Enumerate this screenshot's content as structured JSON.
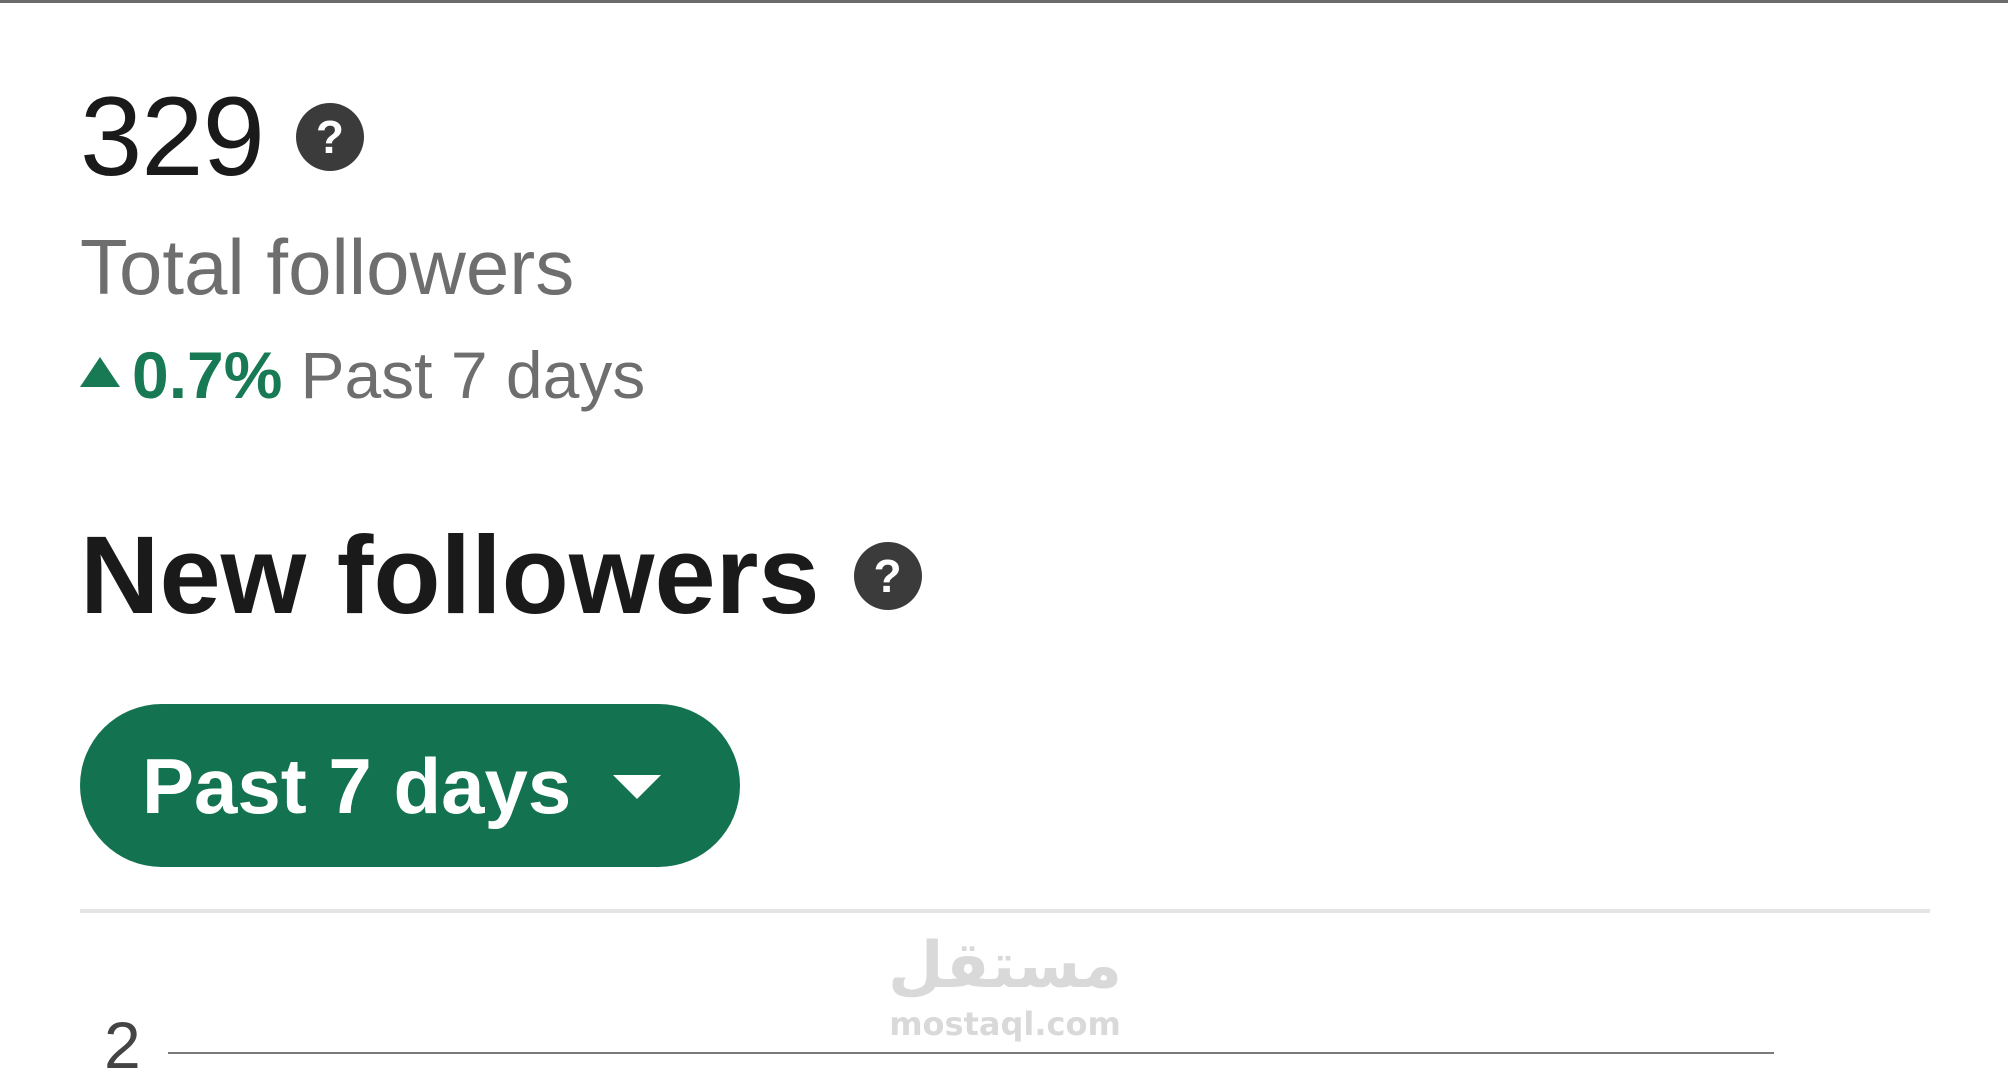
{
  "total": {
    "count": "329",
    "help_icon": "question-circle-icon",
    "label": "Total followers",
    "change": {
      "direction_icon": "triangle-up-icon",
      "percent": "0.7%",
      "period": "Past 7 days"
    }
  },
  "new_followers": {
    "title": "New followers",
    "help_icon": "question-circle-icon",
    "range_select": {
      "value": "Past 7 days",
      "caret_icon": "caret-down-icon"
    },
    "chart_partial": {
      "visible_tick": "2"
    }
  },
  "watermark": {
    "brand": "مستقل",
    "url": "mostaql.com"
  },
  "colors": {
    "accent_green": "#137350",
    "positive_green": "#177a55",
    "help_icon_bg": "#3b3b3b",
    "muted_text": "#6e6e6e"
  }
}
